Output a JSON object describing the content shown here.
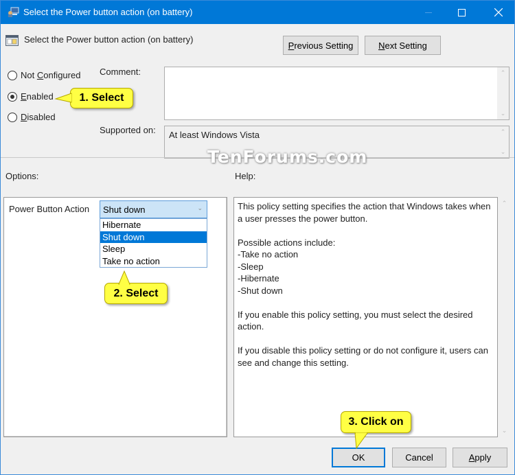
{
  "window": {
    "title": "Select the Power button action (on battery)",
    "controls": {
      "minimize": "minimize",
      "maximize": "maximize",
      "close": "close"
    }
  },
  "header": {
    "policy_title": "Select the Power button action (on battery)",
    "previous_button": {
      "mnemonic": "P",
      "rest": "revious Setting"
    },
    "next_button": {
      "mnemonic": "N",
      "rest": "ext Setting"
    }
  },
  "state": {
    "options": [
      {
        "pre": "Not ",
        "mnemonic": "C",
        "rest": "onfigured",
        "checked": false
      },
      {
        "pre": "",
        "mnemonic": "E",
        "rest": "nabled",
        "checked": true
      },
      {
        "pre": "",
        "mnemonic": "D",
        "rest": "isabled",
        "checked": false
      }
    ]
  },
  "comment": {
    "label": "Comment:",
    "value": ""
  },
  "supported": {
    "label": "Supported on:",
    "value": "At least Windows Vista"
  },
  "watermark": "TenForums.com",
  "options_section": {
    "label": "Options:",
    "field_label": "Power Button Action",
    "selected_value": "Shut down",
    "dropdown_items": [
      "Hibernate",
      "Shut down",
      "Sleep",
      "Take no action"
    ],
    "highlighted_index": 1
  },
  "help_section": {
    "label": "Help:",
    "text": "This policy setting specifies the action that Windows takes when a user presses the power button.\n\nPossible actions include:\n-Take no action\n-Sleep\n-Hibernate\n-Shut down\n\nIf you enable this policy setting, you must select the desired action.\n\nIf you disable this policy setting or do not configure it, users can see and change this setting."
  },
  "footer": {
    "ok": "OK",
    "cancel": "Cancel",
    "apply": {
      "mnemonic": "A",
      "rest": "pply"
    }
  },
  "callouts": {
    "step1": "1. Select",
    "step2": "2. Select",
    "step3": "3. Click on"
  },
  "colors": {
    "titlebar": "#0078d7",
    "selection": "#0078d7",
    "callout": "#ffff44"
  }
}
